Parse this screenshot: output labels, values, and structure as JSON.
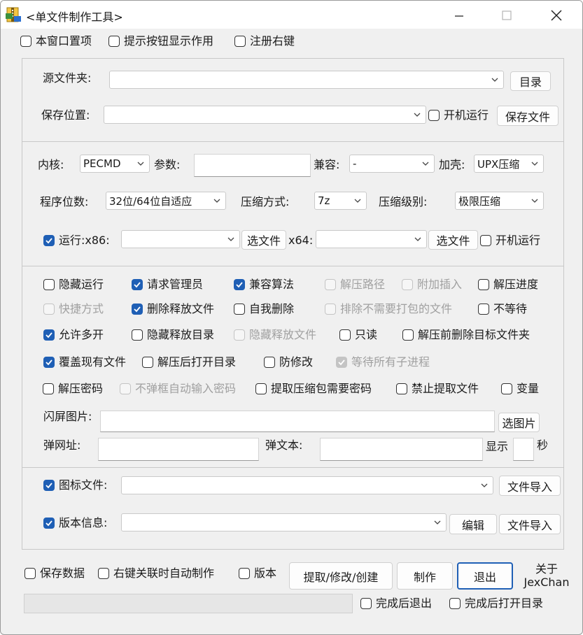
{
  "window": {
    "title": "<单文件制作工具>"
  },
  "options_top": [
    {
      "label": "本窗口置项",
      "checked": false
    },
    {
      "label": "提示按钮显示作用",
      "checked": false
    },
    {
      "label": "注册右键",
      "checked": false
    }
  ],
  "source": {
    "folder_label": "源文件夹:",
    "folder_value": "",
    "dir_button": "目录",
    "save_label": "保存位置:",
    "save_value": "",
    "boot_run": {
      "label": "开机运行",
      "checked": false
    },
    "save_button": "保存文件"
  },
  "core": {
    "kernel_label": "内核:",
    "kernel_value": "PECMD",
    "params_label": "参数:",
    "params_value": "",
    "compat_label": "兼容:",
    "compat_value": "-",
    "shell_label": "加壳:",
    "shell_value": "UPX压缩",
    "bits_label": "程序位数:",
    "bits_value": "32位/64位自适应",
    "compress_label": "压缩方式:",
    "compress_value": "7z",
    "level_label": "压缩级别:",
    "level_value": "极限压缩",
    "run": {
      "label": "运行:x86:",
      "checked": true
    },
    "x86_value": "",
    "pick_file_x86": "选文件",
    "x64_label": "x64:",
    "x64_value": "",
    "pick_file_x64": "选文件",
    "boot_run2": {
      "label": "开机运行",
      "checked": false
    }
  },
  "flags": {
    "row1": [
      {
        "label": "隐藏运行",
        "checked": false,
        "disabled": false
      },
      {
        "label": "请求管理员",
        "checked": true,
        "disabled": false
      },
      {
        "label": "兼容算法",
        "checked": true,
        "disabled": false
      },
      {
        "label": "解压路径",
        "checked": false,
        "disabled": true
      },
      {
        "label": "附加插入",
        "checked": false,
        "disabled": true
      },
      {
        "label": "解压进度",
        "checked": false,
        "disabled": false
      }
    ],
    "row2": [
      {
        "label": "快捷方式",
        "checked": false,
        "disabled": true
      },
      {
        "label": "删除释放文件",
        "checked": true,
        "disabled": false
      },
      {
        "label": "自我删除",
        "checked": false,
        "disabled": false
      },
      {
        "label": "排除不需要打包的文件",
        "checked": false,
        "disabled": true
      },
      {
        "label": "不等待",
        "checked": false,
        "disabled": false
      }
    ],
    "row3": [
      {
        "label": "允许多开",
        "checked": true,
        "disabled": false
      },
      {
        "label": "隐藏释放目录",
        "checked": false,
        "disabled": false
      },
      {
        "label": "隐藏释放文件",
        "checked": false,
        "disabled": true
      },
      {
        "label": "只读",
        "checked": false,
        "disabled": false
      },
      {
        "label": "解压前删除目标文件夹",
        "checked": false,
        "disabled": false
      }
    ],
    "row4": [
      {
        "label": "覆盖现有文件",
        "checked": true,
        "disabled": false
      },
      {
        "label": "解压后打开目录",
        "checked": false,
        "disabled": false
      },
      {
        "label": "防修改",
        "checked": false,
        "disabled": false
      },
      {
        "label": "等待所有子进程",
        "checked": true,
        "disabled": true
      }
    ],
    "row5": [
      {
        "label": "解压密码",
        "checked": false,
        "disabled": false
      },
      {
        "label": "不弹框自动输入密码",
        "checked": false,
        "disabled": true
      },
      {
        "label": "提取压缩包需要密码",
        "checked": false,
        "disabled": false
      },
      {
        "label": "禁止提取文件",
        "checked": false,
        "disabled": false
      },
      {
        "label": "变量",
        "checked": false,
        "disabled": false
      }
    ],
    "splash_label": "闪屏图片:",
    "splash_value": "",
    "pick_image": "选图片",
    "url_label": "弹网址:",
    "url_value": "",
    "text_label": "弹文本:",
    "text_value": "",
    "show_label": "显示",
    "seconds_value": "",
    "seconds_label": "秒"
  },
  "resources": {
    "icon": {
      "label": "图标文件:",
      "checked": true
    },
    "icon_value": "",
    "icon_import": "文件导入",
    "version": {
      "label": "版本信息:",
      "checked": true
    },
    "version_value": "",
    "edit_button": "编辑",
    "version_import": "文件导入"
  },
  "bottom": {
    "save_data": {
      "label": "保存数据",
      "checked": false
    },
    "auto_make": {
      "label": "右键关联时自动制作",
      "checked": false
    },
    "version": {
      "label": "版本",
      "checked": false
    },
    "extract_button": "提取/修改/创建",
    "make_button": "制作",
    "exit_button": "退出",
    "about_line1": "关于",
    "about_line2": "JexChan",
    "exit_after": {
      "label": "完成后退出",
      "checked": false
    },
    "open_after": {
      "label": "完成后打开目录",
      "checked": false
    },
    "progress": 0
  }
}
